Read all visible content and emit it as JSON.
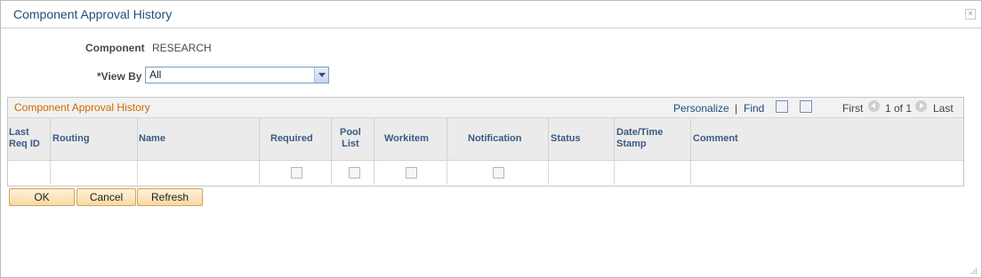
{
  "window": {
    "title": "Component Approval History",
    "close_glyph": "×"
  },
  "form": {
    "component_label": "Component",
    "component_value": "RESEARCH",
    "view_by_label": "*View By",
    "view_by_value": "All"
  },
  "grid": {
    "title": "Component Approval History",
    "personalize": "Personalize",
    "separator": "|",
    "find": "Find",
    "first": "First",
    "page_info": "1 of 1",
    "last": "Last",
    "columns": [
      {
        "label": "Last\nReq ID"
      },
      {
        "label": "Routing"
      },
      {
        "label": "Name"
      },
      {
        "label": "Required"
      },
      {
        "label": "Pool\nList"
      },
      {
        "label": "Workitem"
      },
      {
        "label": "Notification"
      },
      {
        "label": "Status"
      },
      {
        "label": "Date/Time\nStamp"
      },
      {
        "label": "Comment"
      }
    ],
    "rows": [
      {
        "last_req_id": "",
        "routing": "",
        "name": "",
        "required": false,
        "pool_list": false,
        "workitem": false,
        "notification": false,
        "status": "",
        "datetime_stamp": "",
        "comment": ""
      }
    ]
  },
  "buttons": {
    "ok": "OK",
    "cancel": "Cancel",
    "refresh": "Refresh"
  }
}
